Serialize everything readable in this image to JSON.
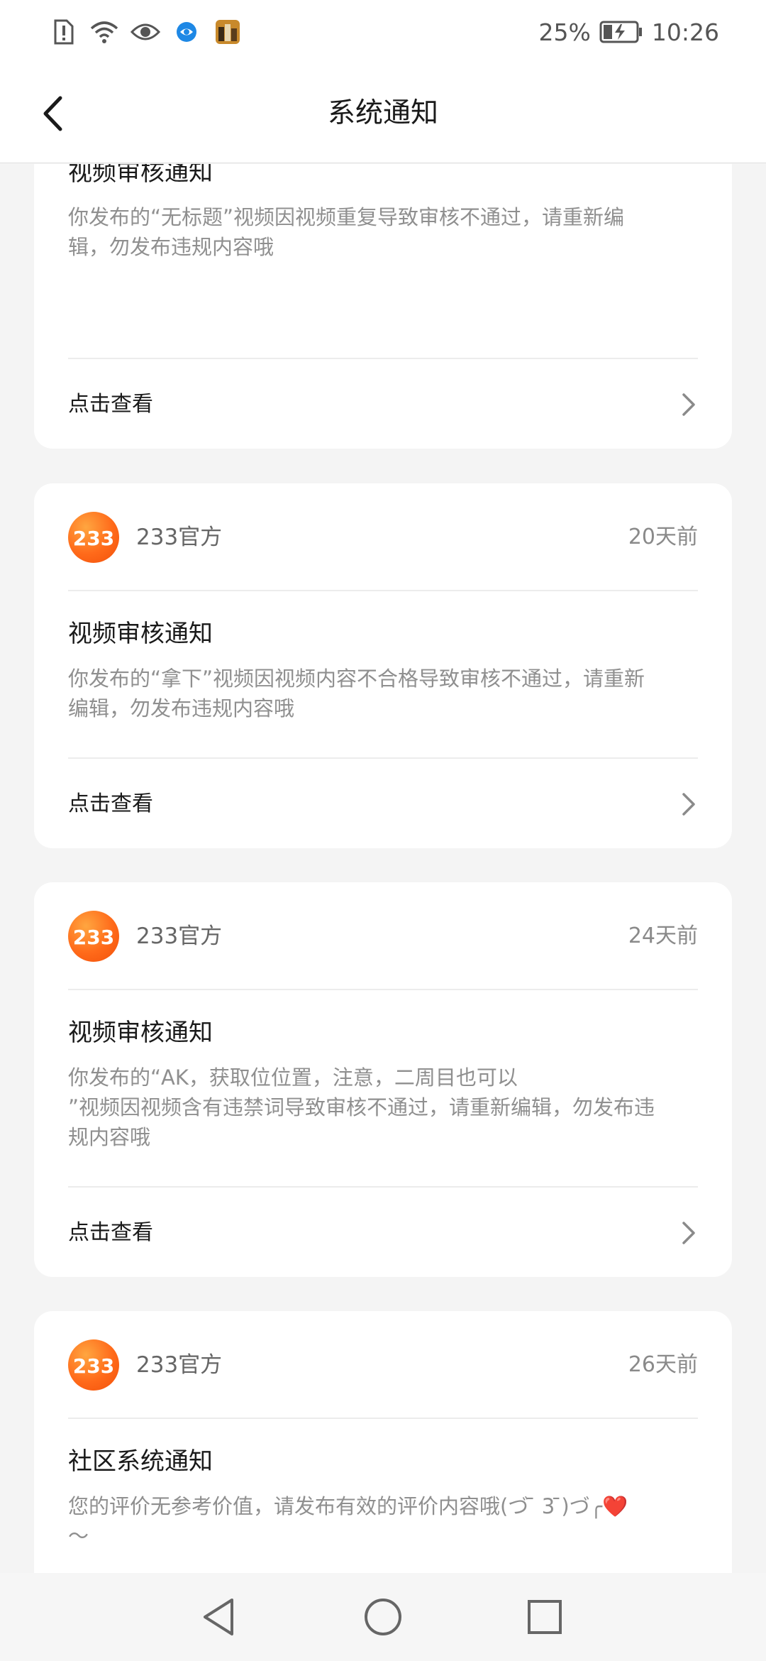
{
  "status_bar": {
    "icons": [
      "alert-icon",
      "wifi-icon",
      "eye-icon",
      "browser-app-icon",
      "game-app-icon"
    ],
    "battery_text": "25%",
    "time": "10:26"
  },
  "header": {
    "back_icon": "chevron-left-icon",
    "title": "系统通知"
  },
  "notifications": [
    {
      "sender": "",
      "time": "",
      "title": "视频审核通知",
      "body": "你发布的“无标题”视频因视频重复导致审核不通过，请重新编\n辑，勿发布违规内容哦",
      "link": "点击查看"
    },
    {
      "avatar_text": "233",
      "sender": "233官方",
      "time": "20天前",
      "title": "视频审核通知",
      "body": "你发布的“拿下”视频因视频内容不合格导致审核不通过，请重新\n编辑，勿发布违规内容哦",
      "link": "点击查看"
    },
    {
      "avatar_text": "233",
      "sender": "233官方",
      "time": "24天前",
      "title": "视频审核通知",
      "body": "你发布的“AK，获取位位置，注意，二周目也可以\n”视频因视频含有违禁词导致审核不通过，请重新编辑，勿发布违\n规内容哦",
      "link": "点击查看"
    },
    {
      "avatar_text": "233",
      "sender": "233官方",
      "time": "26天前",
      "title": "社区系统通知",
      "body": "您的评价无参考价值，请发布有效的评价内容哦(づ ̄ 3 ̄)づ╭❤️\n～"
    }
  ],
  "nav_bar": {
    "back": "triangle-back-icon",
    "home": "circle-home-icon",
    "recents": "square-recents-icon"
  },
  "colors": {
    "background": "#f4f4f4",
    "card": "#ffffff",
    "avatar_orange": "#ff6a1a",
    "text_primary": "#1a1a1a",
    "text_secondary": "#8f8f8f",
    "heart": "#e0202e"
  }
}
